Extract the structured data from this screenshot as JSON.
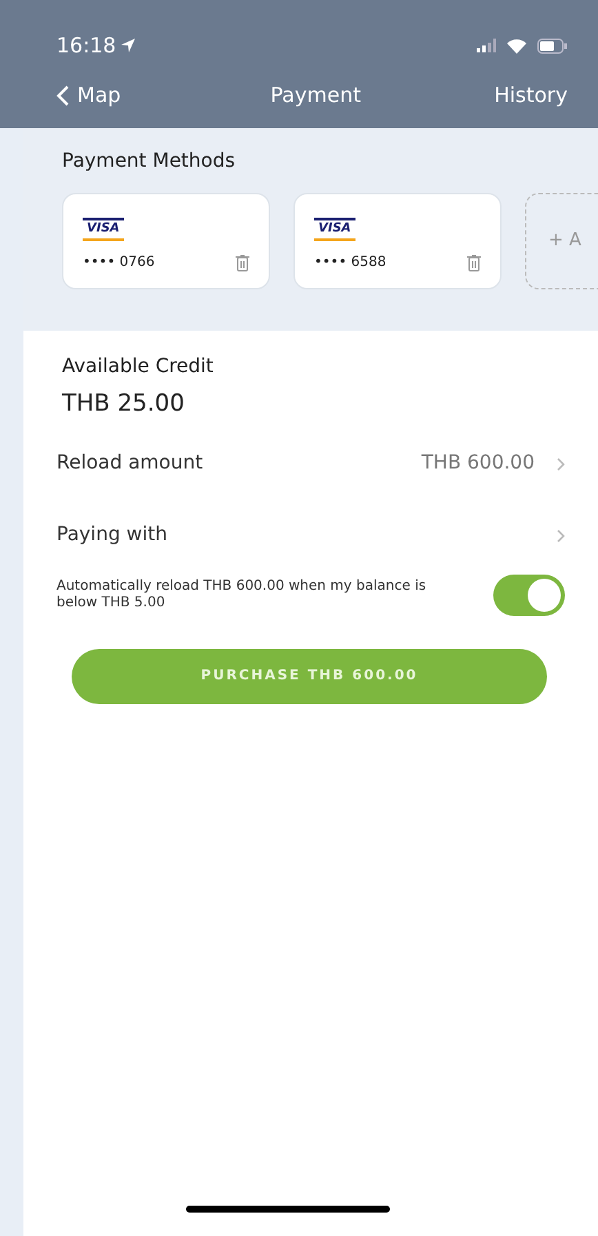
{
  "status_bar": {
    "time": "16:18"
  },
  "nav": {
    "back": "Map",
    "title": "Payment",
    "action": "History"
  },
  "payment_methods": {
    "title": "Payment Methods",
    "cards": [
      {
        "brand": "VISA",
        "number": "•••• 0766"
      },
      {
        "brand": "VISA",
        "number": "•••• 6588"
      }
    ],
    "add_card": "+ A"
  },
  "credit": {
    "label": "Available Credit",
    "amount": "THB 25.00"
  },
  "rows": [
    {
      "label": "Reload amount",
      "value": "THB 600.00"
    },
    {
      "label": "Paying with"
    }
  ],
  "auto_reload": {
    "text": "Automatically reload THB 600.00 when my balance is below THB 5.00",
    "on": true
  },
  "purchase_button": "PURCHASE THB 600.00"
}
